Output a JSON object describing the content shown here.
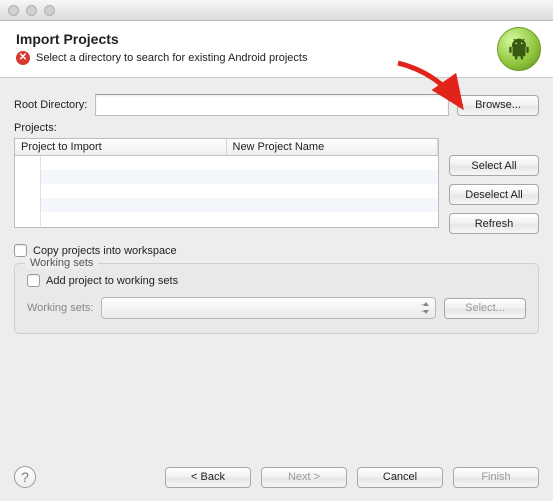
{
  "header": {
    "title": "Import Projects",
    "subtitle": "Select a directory to search for existing Android projects"
  },
  "root_dir": {
    "label": "Root Directory:",
    "value": "",
    "browse": "Browse..."
  },
  "projects_label": "Projects:",
  "columns": {
    "c1": "Project to Import",
    "c2": "New Project Name"
  },
  "side": {
    "select_all": "Select All",
    "deselect_all": "Deselect All",
    "refresh": "Refresh"
  },
  "copy_checkbox": "Copy projects into workspace",
  "working_sets": {
    "group_title": "Working sets",
    "add_label": "Add project to working sets",
    "combo_label": "Working sets:",
    "select_btn": "Select..."
  },
  "footer": {
    "back": "< Back",
    "next": "Next >",
    "cancel": "Cancel",
    "finish": "Finish"
  }
}
